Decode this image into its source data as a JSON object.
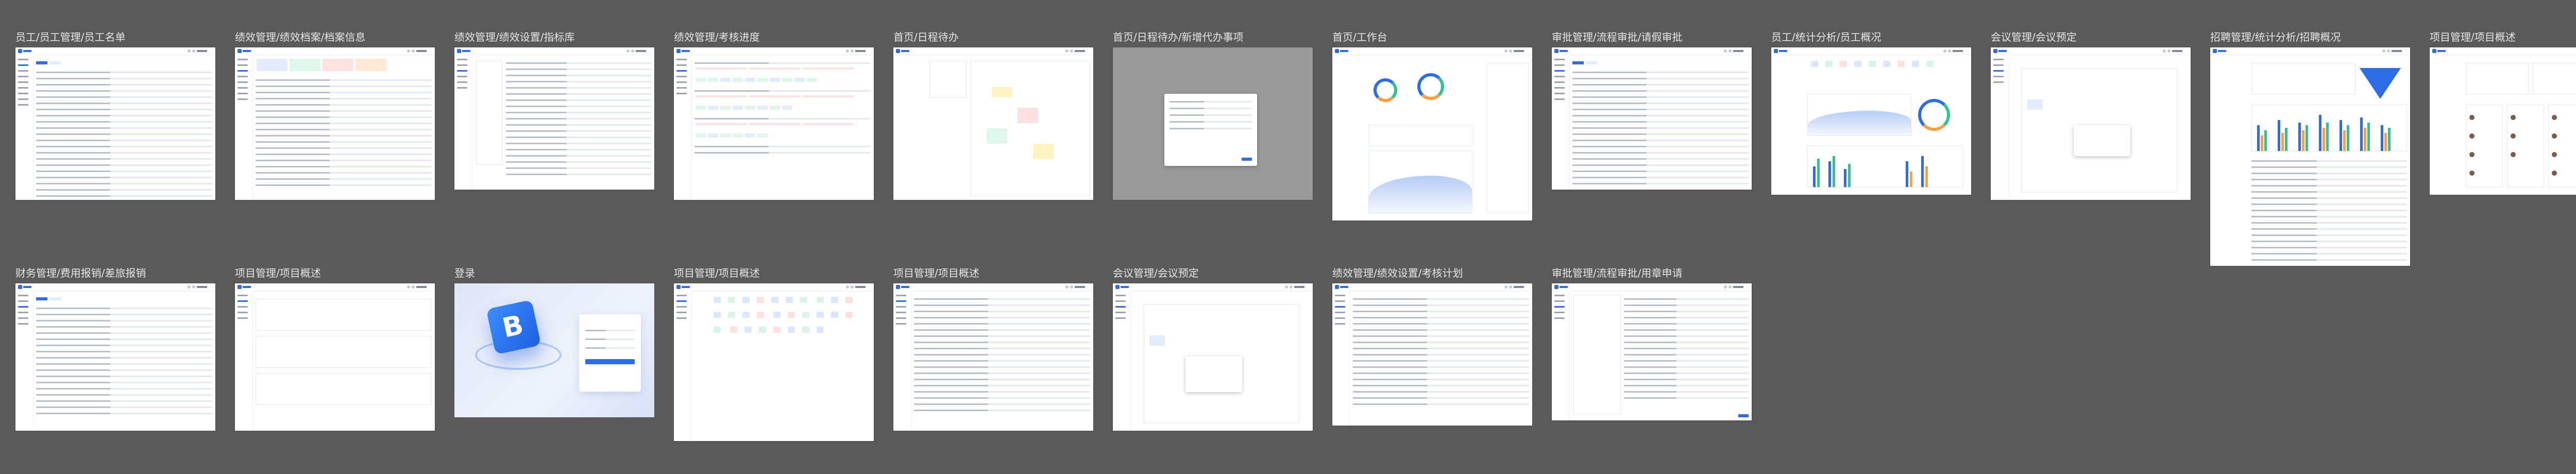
{
  "canvas": {
    "background": "#5a5a5a",
    "accent": "#2e6be6"
  },
  "frames": [
    {
      "id": "f1",
      "title": "员工/员工管理/员工名单",
      "kind": "table"
    },
    {
      "id": "f2",
      "title": "绩效管理/绩效档案/档案信息",
      "kind": "table-cards"
    },
    {
      "id": "f3",
      "title": "绩效管理/绩效设置/指标库",
      "kind": "table-tree"
    },
    {
      "id": "f4",
      "title": "绩效管理/考核进度",
      "kind": "progress"
    },
    {
      "id": "f5",
      "title": "首页/日程待办",
      "kind": "calendar"
    },
    {
      "id": "f6",
      "title": "首页/日程待办/新增代办事项",
      "kind": "modal"
    },
    {
      "id": "f7",
      "title": "首页/工作台",
      "kind": "dashboard"
    },
    {
      "id": "f8",
      "title": "审批管理/流程审批/请假审批",
      "kind": "table"
    },
    {
      "id": "f9",
      "title": "员工/统计分析/员工概况",
      "kind": "stats"
    },
    {
      "id": "f10",
      "title": "会议管理/会议预定",
      "kind": "booking"
    },
    {
      "id": "f11",
      "title": "招聘管理/统计分析/招聘概况",
      "kind": "recruit"
    },
    {
      "id": "f12",
      "title": "项目管理/项目概述",
      "kind": "kanban"
    },
    {
      "id": "f13",
      "title": "财务管理/费用报销/差旅报销",
      "kind": "table"
    },
    {
      "id": "f14",
      "title": "项目管理/项目概述",
      "kind": "project-list"
    },
    {
      "id": "f15",
      "title": "登录",
      "kind": "login"
    },
    {
      "id": "f16",
      "title": "项目管理/项目概述",
      "kind": "tiles"
    },
    {
      "id": "f17",
      "title": "项目管理/项目概述",
      "kind": "table"
    },
    {
      "id": "f18",
      "title": "会议管理/会议预定",
      "kind": "booking"
    },
    {
      "id": "f19",
      "title": "绩效管理/绩效设置/考核计划",
      "kind": "table"
    },
    {
      "id": "f20",
      "title": "审批管理/流程审批/用章申请",
      "kind": "form"
    }
  ]
}
